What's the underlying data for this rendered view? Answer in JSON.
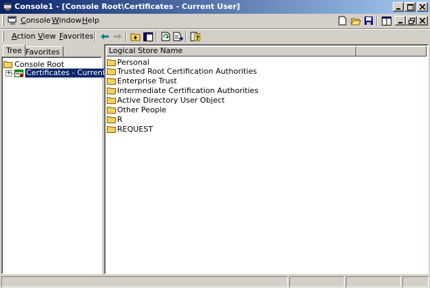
{
  "window": {
    "title": "Console1 - [Console Root\\Certificates - Current User]"
  },
  "menubar": {
    "items": [
      "Console",
      "Window",
      "Help"
    ]
  },
  "actionbar": {
    "items": [
      "Action",
      "View",
      "Favorites"
    ]
  },
  "tabs": [
    "Tree",
    "Favorites"
  ],
  "tree": {
    "root": "Console Root",
    "child": "Certificates - Current User",
    "expander": "+"
  },
  "list": {
    "column_header": "Logical Store Name",
    "items": [
      "Personal",
      "Trusted Root Certification Authorities",
      "Enterprise Trust",
      "Intermediate Certification Authorities",
      "Active Directory User Object",
      "Other People",
      "R",
      "REQUEST"
    ]
  },
  "icons": {
    "app": "mmc-console-icon",
    "caption": [
      "minimize-icon",
      "maximize-icon",
      "close-icon"
    ],
    "menu_tools": [
      "new-icon",
      "open-folder-icon",
      "save-icon",
      "tile-icon"
    ],
    "mdi": [
      "minimize-icon",
      "restore-icon",
      "close-icon"
    ],
    "toolbar": [
      "back-arrow-icon",
      "forward-arrow-icon",
      "up-folder-icon",
      "show-hide-tree-icon",
      "refresh-icon",
      "export-list-icon",
      "help-icon"
    ],
    "folder": "folder-icon",
    "certificates": "certificates-icon"
  },
  "colors": {
    "titlebar_start": "#0a246a",
    "titlebar_end": "#a6caf0",
    "selection": "#0a246a",
    "folder": "#f0d060"
  }
}
